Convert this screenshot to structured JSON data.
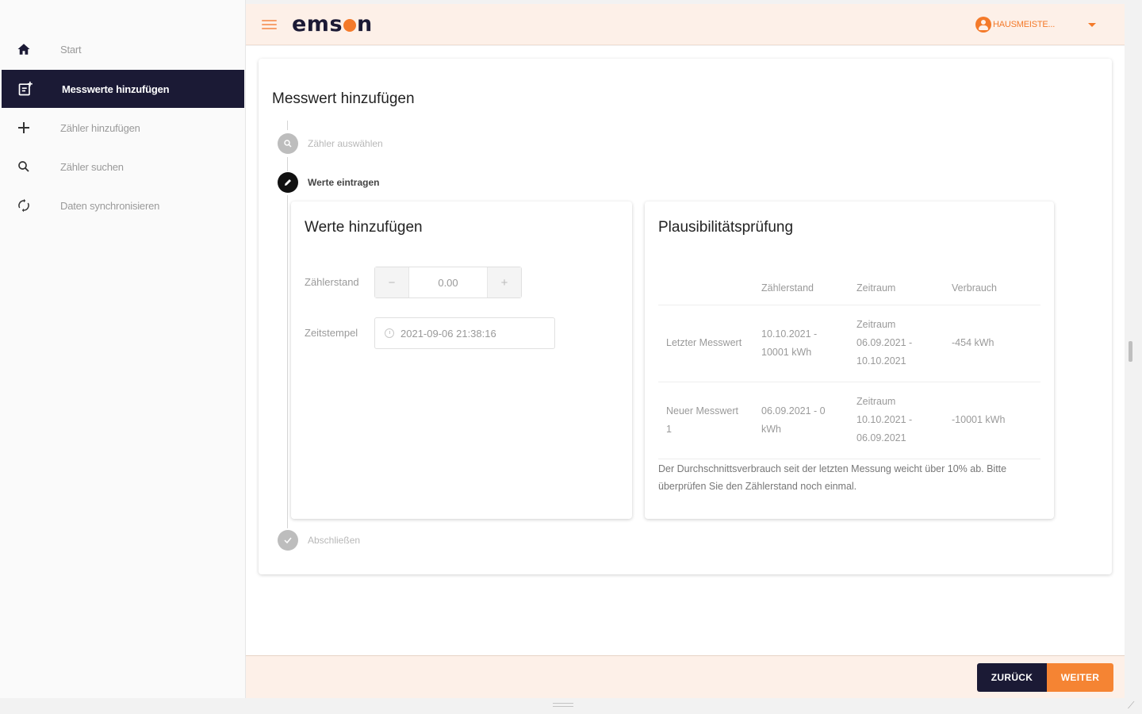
{
  "sidebar": {
    "items": [
      {
        "label": "Start",
        "icon": "home-icon"
      },
      {
        "label": "Messwerte hinzufügen",
        "icon": "add-reading-icon",
        "active": true
      },
      {
        "label": "Zähler hinzufügen",
        "icon": "plus-icon"
      },
      {
        "label": "Zähler suchen",
        "icon": "search-icon"
      },
      {
        "label": "Daten synchronisieren",
        "icon": "sync-icon"
      }
    ]
  },
  "header": {
    "logo": {
      "before": "ems",
      "after": "n"
    },
    "user_name": "HAUSMEISTE..."
  },
  "main": {
    "title": "Messwert hinzufügen",
    "steps": [
      {
        "label": "Zähler auswählen",
        "icon": "search-icon"
      },
      {
        "label": "Werte eintragen",
        "icon": "pencil-icon",
        "active": true
      },
      {
        "label": "Abschließen",
        "icon": "check-icon"
      }
    ],
    "values_panel": {
      "title": "Werte hinzufügen",
      "meter_label": "Zählerstand",
      "meter_value": "0.00",
      "minus": "−",
      "plus": "+",
      "timestamp_label": "Zeitstempel",
      "timestamp_value": "2021-09-06 21:38:16"
    },
    "plausibility_panel": {
      "title": "Plausibilitätsprüfung",
      "columns": [
        "",
        "Zählerstand",
        "Zeitraum",
        "Verbrauch"
      ],
      "rows": [
        [
          "Letzter Messwert",
          "10.10.2021 - 10001 kWh",
          "Zeitraum 06.09.2021 - 10.10.2021",
          "-454 kWh"
        ],
        [
          "Neuer Messwert 1",
          "06.09.2021 - 0 kWh",
          "Zeitraum 10.10.2021 - 06.09.2021",
          "-10001 kWh"
        ]
      ],
      "hint": "Der Durchschnittsverbrauch seit der letzten Messung weicht über 10% ab. Bitte überprüfen Sie den Zählerstand noch einmal."
    }
  },
  "footer": {
    "back_label": "ZURÜCK",
    "next_label": "WEITER"
  },
  "colors": {
    "brand_dark": "#1b1a35",
    "brand_orange": "#f47a2a",
    "header_bg": "#fdf0e8"
  }
}
